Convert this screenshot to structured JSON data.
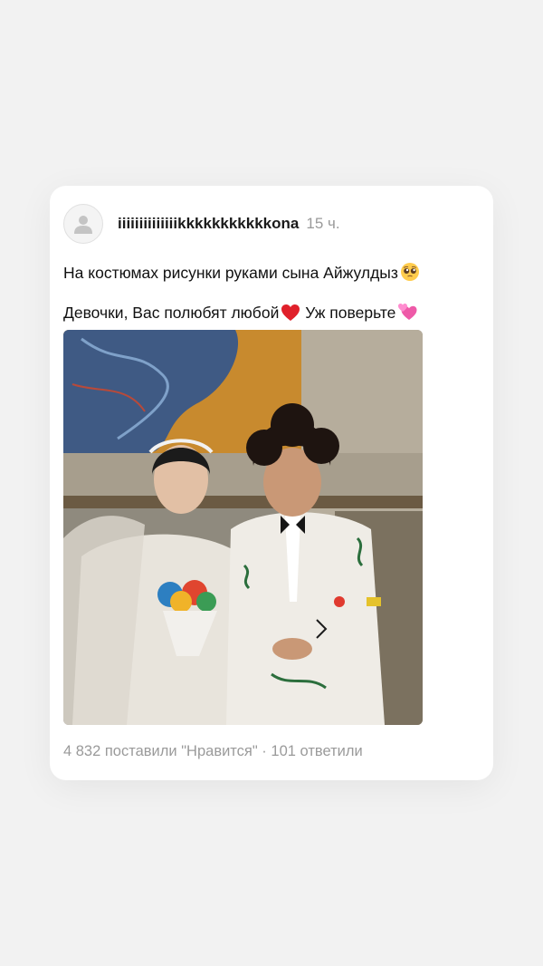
{
  "post": {
    "username": "iiiiiiiiiiiiiikkkkkkkkkkkona",
    "time": "15 ч.",
    "text_line_1": "На костюмах рисунки руками сына Айжулдыз",
    "text_line_2a": "Девочки, Вас полюбят любой",
    "text_line_2b": " Уж поверьте",
    "emojis": [
      "pleading-face-emoji",
      "red-heart-emoji",
      "two-hearts-emoji"
    ],
    "photo_alt": "wedding photo",
    "likes": "4 832 поставили \"Нравится\"",
    "separator": " · ",
    "replies": "101 ответили"
  },
  "colors": {
    "background": "#f2f2f2",
    "card": "#ffffff",
    "muted_text": "#9a9a9a",
    "primary_text": "#111111"
  }
}
